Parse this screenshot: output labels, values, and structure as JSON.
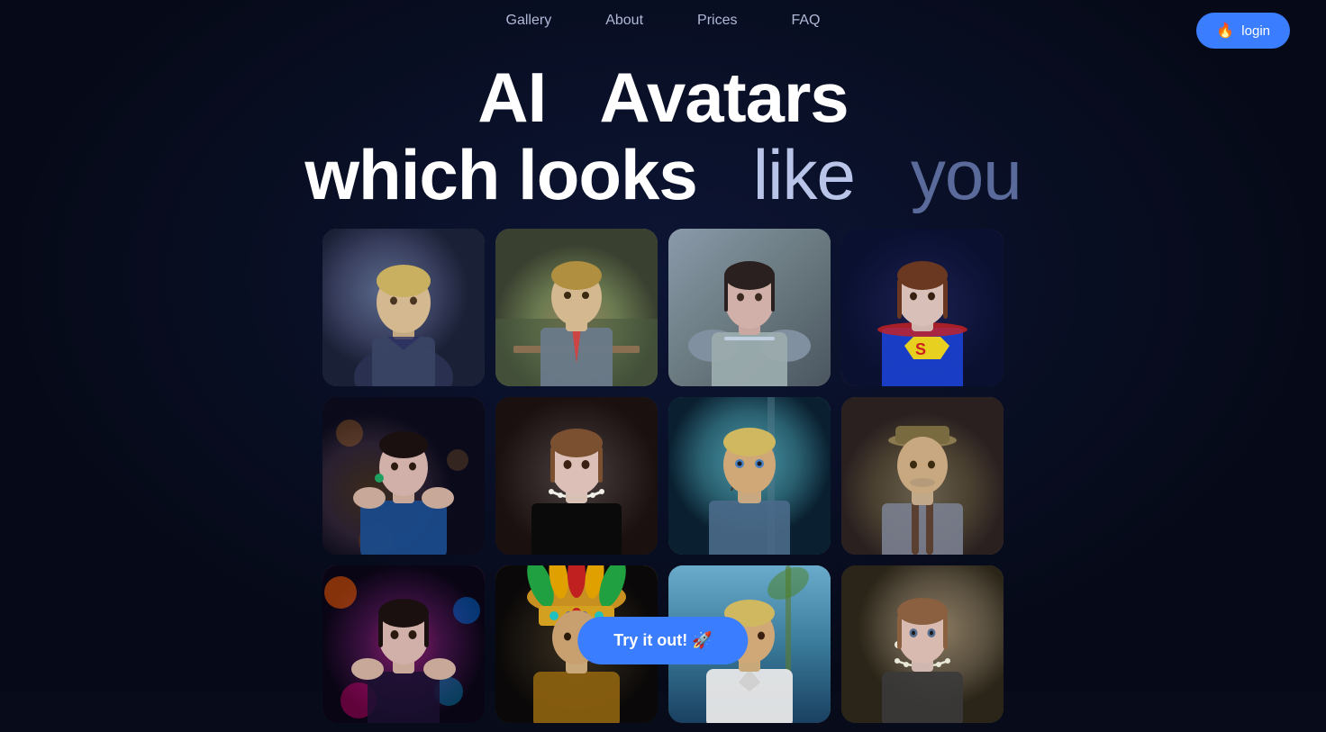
{
  "nav": {
    "links": [
      {
        "label": "Gallery",
        "id": "gallery"
      },
      {
        "label": "About",
        "id": "about"
      },
      {
        "label": "Prices",
        "id": "prices"
      },
      {
        "label": "FAQ",
        "id": "faq"
      }
    ],
    "login_label": "login",
    "login_icon": "🔥"
  },
  "hero": {
    "line1_part1": "AI",
    "line1_part2": "Avatars",
    "line2_part1": "which looks",
    "line2_part2": "like",
    "line2_part3": "you"
  },
  "gallery": {
    "images": [
      {
        "id": "av1",
        "alt": "Man in sci-fi outfit indoors"
      },
      {
        "id": "av2",
        "alt": "Man in suit at desk with books"
      },
      {
        "id": "av3",
        "alt": "Woman in medieval armor outdoors"
      },
      {
        "id": "av4",
        "alt": "Woman in Supergirl costume"
      },
      {
        "id": "av5",
        "alt": "Woman in blue evening dress"
      },
      {
        "id": "av6",
        "alt": "Woman with pearl necklace close up"
      },
      {
        "id": "av7",
        "alt": "Man with tattoos face paint"
      },
      {
        "id": "av8",
        "alt": "Man in vintage hat and suspenders"
      },
      {
        "id": "av9",
        "alt": "Woman at colorful party festival"
      },
      {
        "id": "av10",
        "alt": "Man in ancient Aztec headdress"
      },
      {
        "id": "av11",
        "alt": "Man with sunglasses outdoors palm tree"
      },
      {
        "id": "av12",
        "alt": "Woman with pearl necklace natural light"
      }
    ]
  },
  "cta": {
    "label": "Try it out! 🚀"
  }
}
